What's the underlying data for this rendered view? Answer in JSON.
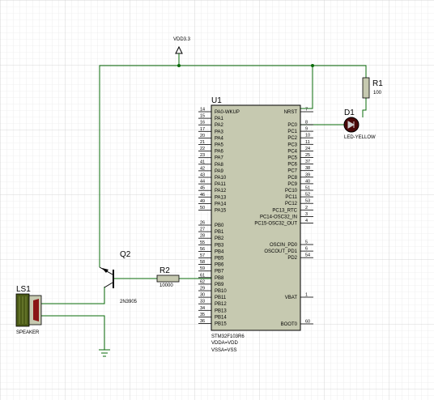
{
  "power": {
    "label": "VDD3.3"
  },
  "mcu": {
    "ref": "U1",
    "part": "STM32F103R6",
    "notes": [
      "VDDA=VDD",
      "VSSA=VSS"
    ],
    "left_pins": [
      {
        "num": "14",
        "name": "PA0-WKUP"
      },
      {
        "num": "15",
        "name": "PA1"
      },
      {
        "num": "16",
        "name": "PA2"
      },
      {
        "num": "17",
        "name": "PA3"
      },
      {
        "num": "20",
        "name": "PA4"
      },
      {
        "num": "21",
        "name": "PA5"
      },
      {
        "num": "22",
        "name": "PA6"
      },
      {
        "num": "23",
        "name": "PA7"
      },
      {
        "num": "41",
        "name": "PA8"
      },
      {
        "num": "42",
        "name": "PA9"
      },
      {
        "num": "43",
        "name": "PA10"
      },
      {
        "num": "44",
        "name": "PA11"
      },
      {
        "num": "45",
        "name": "PA12"
      },
      {
        "num": "46",
        "name": "PA13"
      },
      {
        "num": "49",
        "name": "PA14"
      },
      {
        "num": "50",
        "name": "PA15"
      },
      {
        "num": "26",
        "name": "PB0"
      },
      {
        "num": "27",
        "name": "PB1"
      },
      {
        "num": "28",
        "name": "PB2"
      },
      {
        "num": "55",
        "name": "PB3"
      },
      {
        "num": "56",
        "name": "PB4"
      },
      {
        "num": "57",
        "name": "PB5"
      },
      {
        "num": "58",
        "name": "PB6"
      },
      {
        "num": "59",
        "name": "PB7"
      },
      {
        "num": "61",
        "name": "PB8"
      },
      {
        "num": "62",
        "name": "PB9"
      },
      {
        "num": "29",
        "name": "PB10"
      },
      {
        "num": "30",
        "name": "PB11"
      },
      {
        "num": "33",
        "name": "PB12"
      },
      {
        "num": "34",
        "name": "PB13"
      },
      {
        "num": "35",
        "name": "PB14"
      },
      {
        "num": "36",
        "name": "PB15"
      }
    ],
    "right_pins": [
      {
        "num": "7",
        "name": "NRST"
      },
      {
        "num": "8",
        "name": "PC0"
      },
      {
        "num": "9",
        "name": "PC1"
      },
      {
        "num": "10",
        "name": "PC2"
      },
      {
        "num": "11",
        "name": "PC3"
      },
      {
        "num": "24",
        "name": "PC4"
      },
      {
        "num": "25",
        "name": "PC5"
      },
      {
        "num": "37",
        "name": "PC6"
      },
      {
        "num": "38",
        "name": "PC7"
      },
      {
        "num": "39",
        "name": "PC8"
      },
      {
        "num": "40",
        "name": "PC9"
      },
      {
        "num": "51",
        "name": "PC10"
      },
      {
        "num": "52",
        "name": "PC11"
      },
      {
        "num": "53",
        "name": "PC12"
      },
      {
        "num": "2",
        "name": "PC13_RTC"
      },
      {
        "num": "3",
        "name": "PC14-OSC32_IN"
      },
      {
        "num": "4",
        "name": "PC15-OSC32_OUT"
      },
      {
        "num": "5",
        "name": "OSCIN_PD0"
      },
      {
        "num": "6",
        "name": "OSCOUT_PD1"
      },
      {
        "num": "54",
        "name": "PD2"
      },
      {
        "num": "1",
        "name": "VBAT"
      },
      {
        "num": "60",
        "name": "BOOT0"
      }
    ]
  },
  "r1": {
    "ref": "R1",
    "value": "100"
  },
  "d1": {
    "ref": "D1",
    "value": "LED-YELLOW"
  },
  "r2": {
    "ref": "R2",
    "value": "10000"
  },
  "q2": {
    "ref": "Q2",
    "value": "2N3905"
  },
  "ls1": {
    "ref": "LS1",
    "value": "SPEAKER"
  }
}
